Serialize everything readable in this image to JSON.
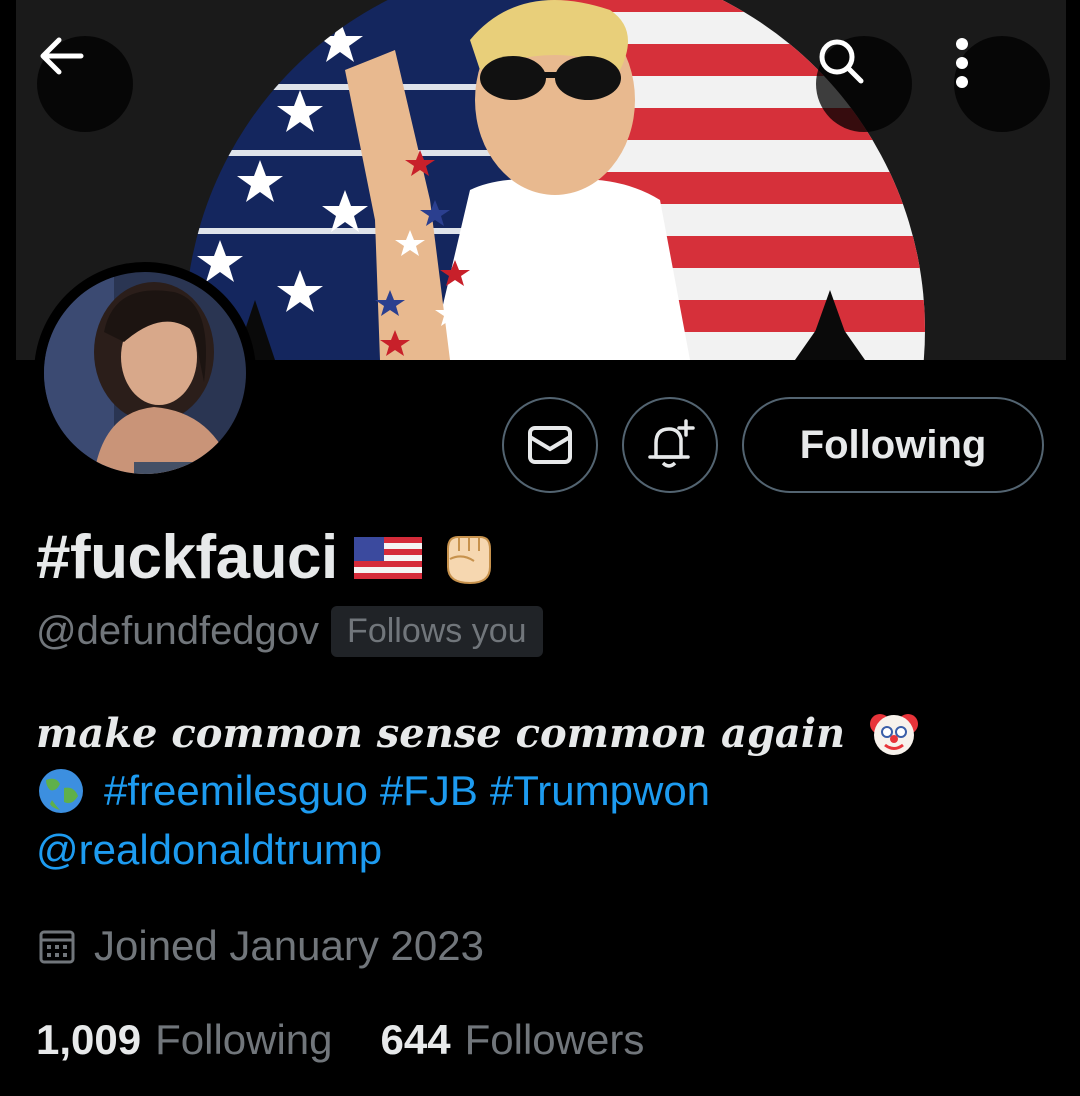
{
  "profile": {
    "display_name": "#fuckfauci",
    "handle": "@defundfedgov",
    "follows_you_badge": "Follows you",
    "bio": {
      "line1": "make common sense common again",
      "line2_tags": [
        "#freemilesguo",
        "#FJB",
        "#Trumpwon"
      ],
      "line3_mention": "@realdonaldtrump"
    },
    "joined": "Joined January 2023",
    "stats": {
      "following_count": "1,009",
      "following_label": "Following",
      "followers_count": "644",
      "followers_label": "Followers"
    }
  },
  "actions": {
    "follow_state_label": "Following"
  },
  "icons": {
    "back": "arrow-left-icon",
    "search": "search-icon",
    "more": "more-vertical-icon",
    "message": "mail-icon",
    "notify": "bell-plus-icon",
    "calendar": "calendar-icon",
    "flag": "us-flag-emoji",
    "fist": "raised-fist-emoji",
    "clown": "clown-face-emoji",
    "globe": "globe-emoji"
  },
  "colors": {
    "background": "#000000",
    "primary_text": "#e7e9ea",
    "secondary_text": "#71767b",
    "link": "#1d9bf0",
    "border": "#536471"
  }
}
